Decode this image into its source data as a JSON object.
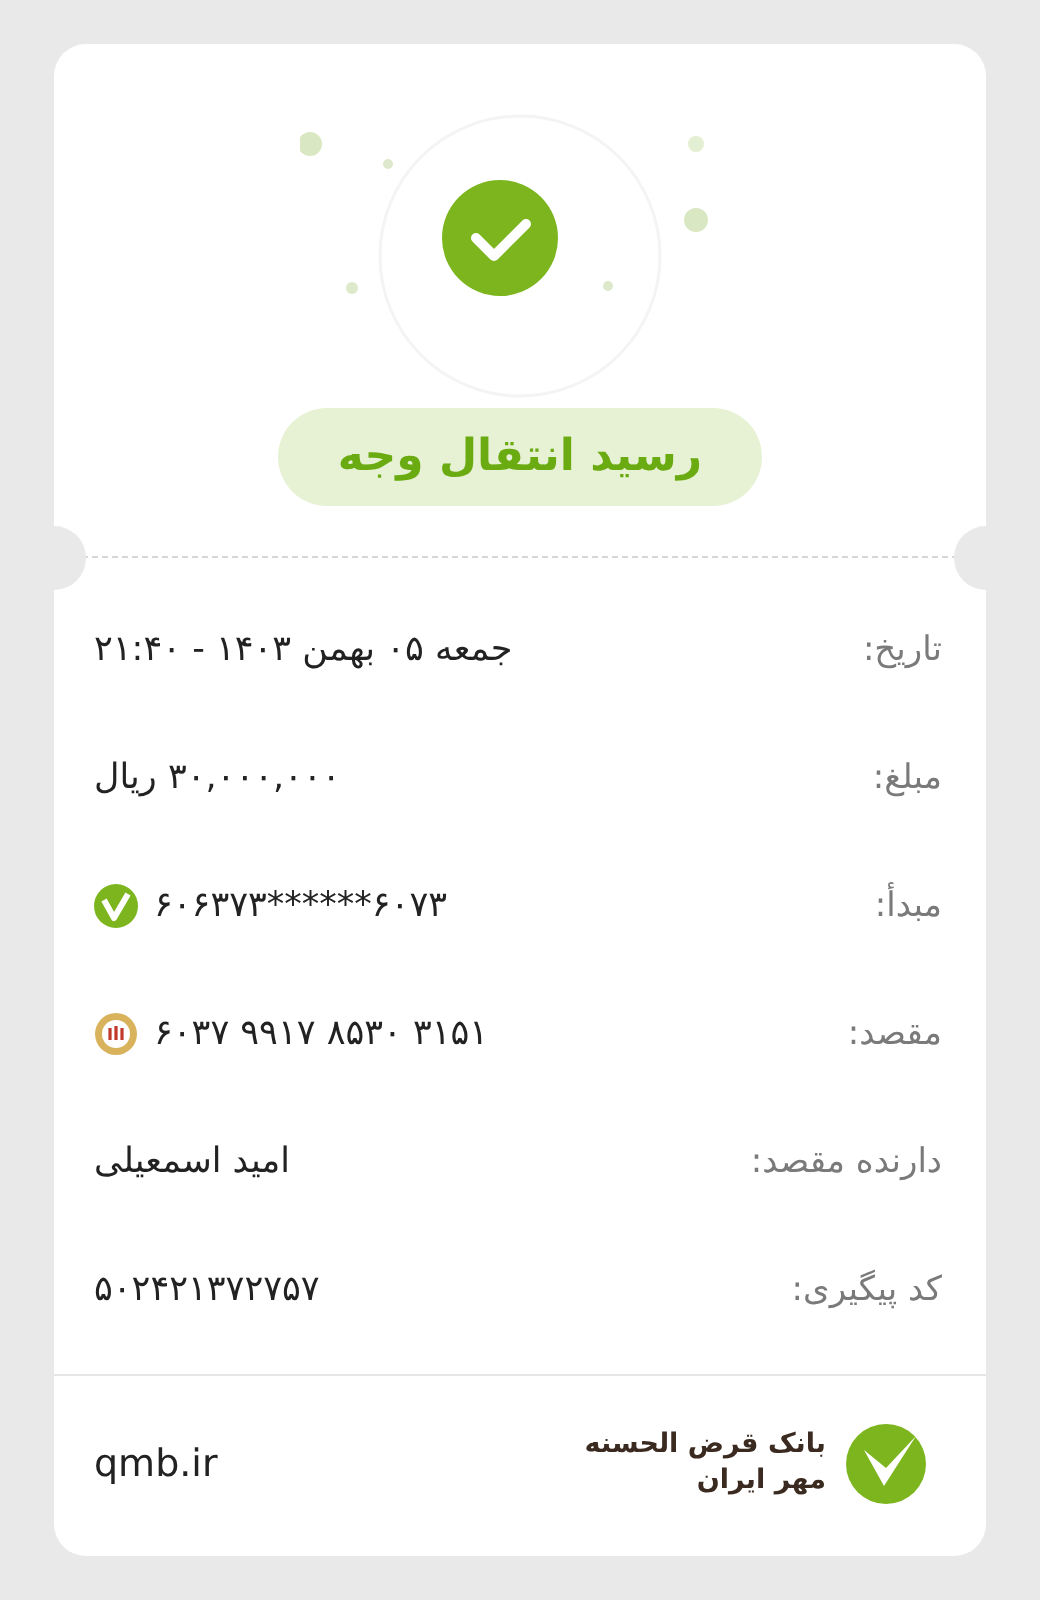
{
  "header": {
    "title": "رسید انتقال وجه"
  },
  "rows": [
    {
      "label": "تاریخ:",
      "value": "جمعه ۰۵ بهمن ۱۴۰۳ - ۲۱:۴۰"
    },
    {
      "label": "مبلغ:",
      "value": "۳۰,۰۰۰,۰۰۰ ریال"
    },
    {
      "label": "مبدأ:",
      "value": "۶۰۶۳۷۳******۶۰۷۳",
      "kind": "check"
    },
    {
      "label": "مقصد:",
      "value": "۶۰۳۷ ۹۹۱۷ ۸۵۳۰ ۳۱۵۱",
      "kind": "emblem"
    },
    {
      "label": "دارنده مقصد:",
      "value": "امید اسمعیلی"
    },
    {
      "label": "کد پیگیری:",
      "value": "۵۰۲۴۲۱۳۷۲۷۵۷"
    }
  ],
  "footer": {
    "bank_name_line_1": "بانک قرض الحسنه",
    "bank_name_line_2": "مهر ایران",
    "website": "qmb.ir"
  }
}
